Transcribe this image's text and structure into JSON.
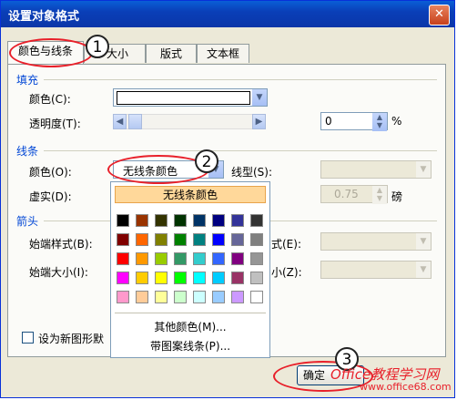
{
  "window": {
    "title": "设置对象格式",
    "close_glyph": "✕"
  },
  "tabs": [
    {
      "label": "颜色与线条"
    },
    {
      "label": "大小"
    },
    {
      "label": "版式"
    },
    {
      "label": "文本框"
    }
  ],
  "fill": {
    "section": "填充",
    "color_label": "颜色(C):",
    "transparency_label": "透明度(T):",
    "transparency_value": "0",
    "percent": "%"
  },
  "line": {
    "section": "线条",
    "color_label": "颜色(O):",
    "color_value": "无线条颜色",
    "style_label": "线型(S):",
    "dash_label": "虚实(D):",
    "weight_value": "0.75",
    "weight_unit": "磅"
  },
  "arrows": {
    "section": "箭头",
    "begin_style_label": "始端样式(B):",
    "begin_size_label": "始端大小(I):",
    "end_style_suffix": "式(E):",
    "end_size_suffix": "小(Z):"
  },
  "popup": {
    "no_color": "无线条颜色",
    "more_colors": "其他颜色(M)...",
    "patterned_lines": "带图案线条(P)...",
    "swatches": [
      [
        "#000000",
        "#993300",
        "#333300",
        "#003300",
        "#003366",
        "#000080",
        "#333399",
        "#333333"
      ],
      [
        "#800000",
        "#ff6600",
        "#808000",
        "#008000",
        "#008080",
        "#0000ff",
        "#666699",
        "#808080"
      ],
      [
        "#ff0000",
        "#ff9900",
        "#99cc00",
        "#339966",
        "#33cccc",
        "#3366ff",
        "#800080",
        "#969696"
      ],
      [
        "#ff00ff",
        "#ffcc00",
        "#ffff00",
        "#00ff00",
        "#00ffff",
        "#00ccff",
        "#993366",
        "#c0c0c0"
      ],
      [
        "#ff99cc",
        "#ffcc99",
        "#ffff99",
        "#ccffcc",
        "#ccffff",
        "#99ccff",
        "#cc99ff",
        "#ffffff"
      ]
    ]
  },
  "default_checkbox_label": "设为新图形默",
  "ok_button": "确定",
  "callouts": [
    "1",
    "2",
    "3"
  ],
  "watermark": {
    "line1": "Office教程学习网",
    "line2": "www.office68.com"
  }
}
